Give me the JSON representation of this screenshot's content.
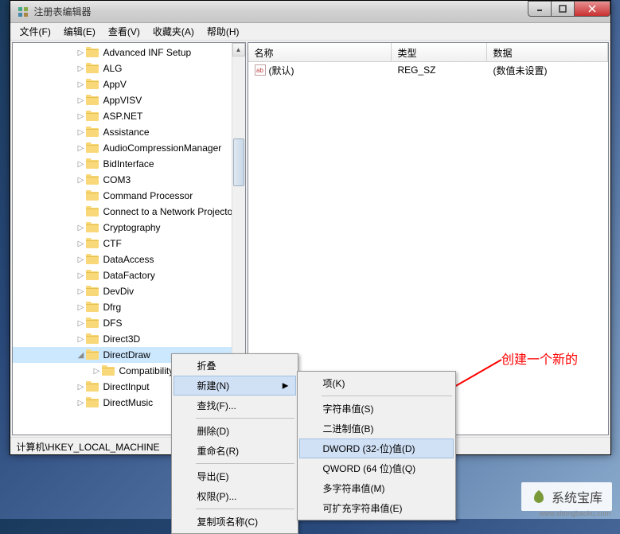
{
  "window": {
    "title": "注册表编辑器"
  },
  "menu": {
    "file": "文件(F)",
    "edit": "编辑(E)",
    "view": "查看(V)",
    "favorites": "收藏夹(A)",
    "help": "帮助(H)"
  },
  "tree": {
    "items": [
      {
        "label": "Advanced INF Setup",
        "expand": "▷"
      },
      {
        "label": "ALG",
        "expand": "▷"
      },
      {
        "label": "AppV",
        "expand": "▷"
      },
      {
        "label": "AppVISV",
        "expand": "▷"
      },
      {
        "label": "ASP.NET",
        "expand": "▷"
      },
      {
        "label": "Assistance",
        "expand": "▷"
      },
      {
        "label": "AudioCompressionManager",
        "expand": "▷"
      },
      {
        "label": "BidInterface",
        "expand": "▷"
      },
      {
        "label": "COM3",
        "expand": "▷"
      },
      {
        "label": "Command Processor",
        "expand": ""
      },
      {
        "label": "Connect to a Network Projector",
        "expand": ""
      },
      {
        "label": "Cryptography",
        "expand": "▷"
      },
      {
        "label": "CTF",
        "expand": "▷"
      },
      {
        "label": "DataAccess",
        "expand": "▷"
      },
      {
        "label": "DataFactory",
        "expand": "▷"
      },
      {
        "label": "DevDiv",
        "expand": "▷"
      },
      {
        "label": "Dfrg",
        "expand": "▷"
      },
      {
        "label": "DFS",
        "expand": "▷"
      },
      {
        "label": "Direct3D",
        "expand": "▷"
      },
      {
        "label": "DirectDraw",
        "expand": "◢",
        "selected": true
      },
      {
        "label": "Compatibility",
        "expand": "▷",
        "child": true
      },
      {
        "label": "DirectInput",
        "expand": "▷"
      },
      {
        "label": "DirectMusic",
        "expand": "▷"
      }
    ]
  },
  "list": {
    "columns": {
      "name": "名称",
      "type": "类型",
      "data": "数据"
    },
    "col_widths": {
      "name": 180,
      "type": 120,
      "data": 160
    },
    "rows": [
      {
        "name": "(默认)",
        "type": "REG_SZ",
        "data": "(数值未设置)"
      }
    ]
  },
  "statusbar": {
    "path": "计算机\\HKEY_LOCAL_MACHINE"
  },
  "context_menu": {
    "items": [
      {
        "label": "折叠"
      },
      {
        "label": "新建(N)",
        "submenu": true,
        "hover": true
      },
      {
        "label": "查找(F)..."
      },
      {
        "sep": true
      },
      {
        "label": "删除(D)"
      },
      {
        "label": "重命名(R)"
      },
      {
        "sep": true
      },
      {
        "label": "导出(E)"
      },
      {
        "label": "权限(P)..."
      },
      {
        "sep": true
      },
      {
        "label": "复制项名称(C)"
      }
    ],
    "submenu": [
      {
        "label": "项(K)"
      },
      {
        "sep": true
      },
      {
        "label": "字符串值(S)"
      },
      {
        "label": "二进制值(B)"
      },
      {
        "label": "DWORD (32-位)值(D)",
        "highlight": true
      },
      {
        "label": "QWORD (64 位)值(Q)"
      },
      {
        "label": "多字符串值(M)"
      },
      {
        "label": "可扩充字符串值(E)"
      }
    ]
  },
  "annotation": {
    "text": "创建一个新的"
  },
  "watermark": {
    "text": "系统宝库",
    "url": "www.xitongbaoku.com"
  }
}
